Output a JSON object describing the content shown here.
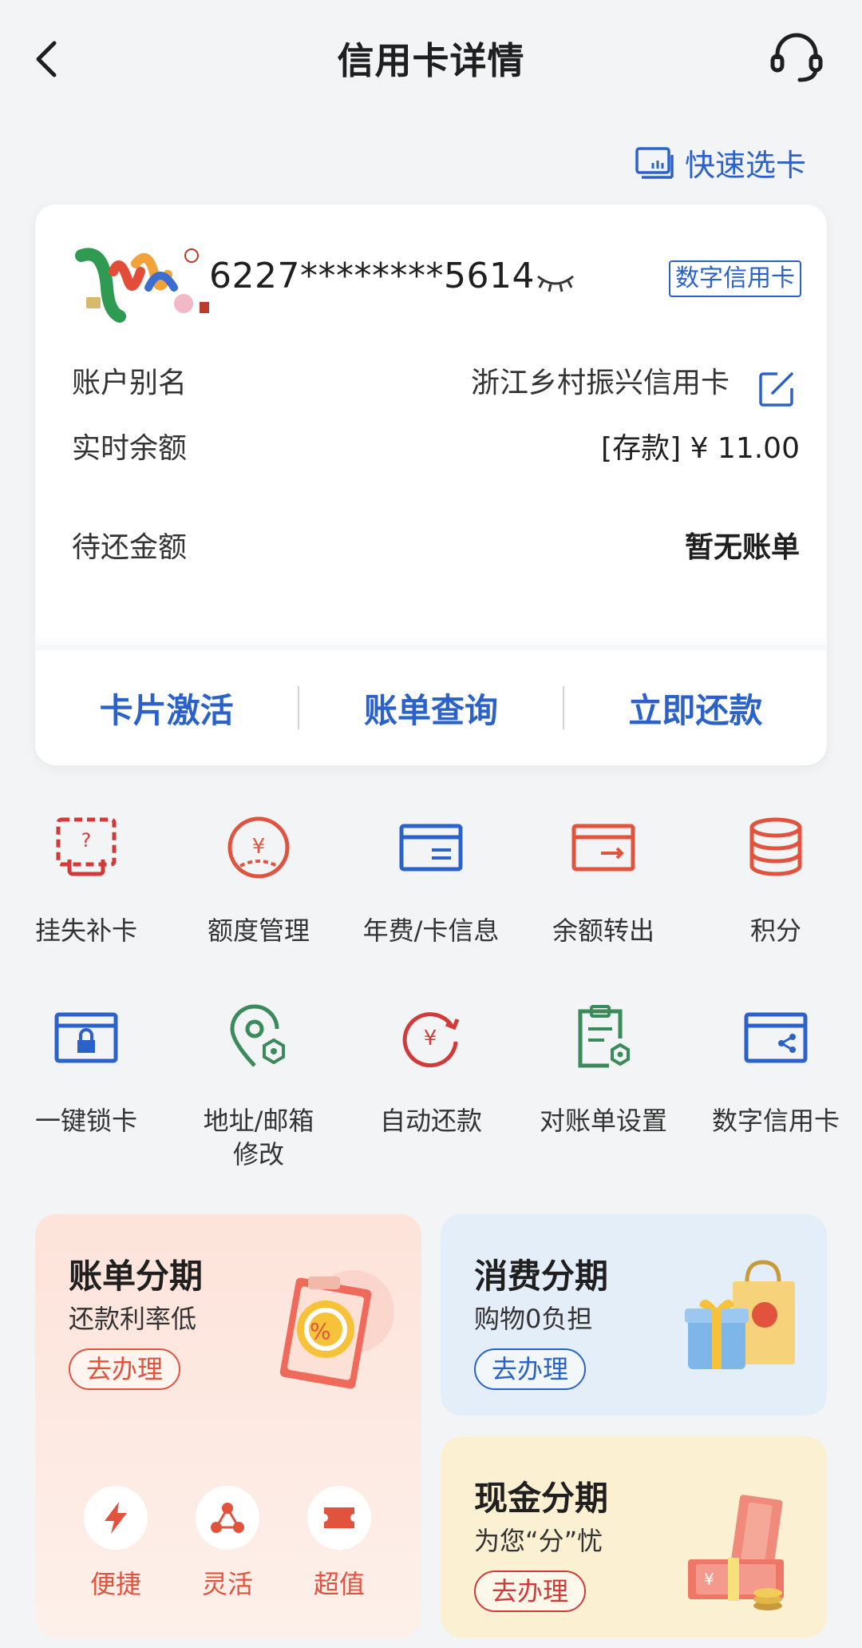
{
  "header": {
    "title": "信用卡详情"
  },
  "quick_select": {
    "label": "快速选卡"
  },
  "card": {
    "number": "6227********5614",
    "badge": "数字信用卡",
    "alias_label": "账户别名",
    "alias_value": "浙江乡村振兴信用卡",
    "balance_label": "实时余额",
    "balance_value": "[存款] ¥ 11.00",
    "due_label": "待还金额",
    "due_value": "暂无账单",
    "actions": [
      "卡片激活",
      "账单查询",
      "立即还款"
    ]
  },
  "services_row1": [
    {
      "label": "挂失补卡",
      "icon": "report-loss-icon"
    },
    {
      "label": "额度管理",
      "icon": "credit-limit-icon"
    },
    {
      "label": "年费/卡信息",
      "icon": "card-info-icon"
    },
    {
      "label": "余额转出",
      "icon": "balance-transfer-icon"
    },
    {
      "label": "积分",
      "icon": "points-icon"
    }
  ],
  "services_row2": [
    {
      "label": "一键锁卡",
      "icon": "lock-card-icon"
    },
    {
      "label_line1": "地址/邮箱",
      "label_line2": "修改",
      "icon": "address-icon"
    },
    {
      "label": "自动还款",
      "icon": "auto-repay-icon"
    },
    {
      "label": "对账单设置",
      "icon": "statement-settings-icon"
    },
    {
      "label": "数字信用卡",
      "icon": "digital-card-icon"
    }
  ],
  "promos": {
    "bill_installment": {
      "title": "账单分期",
      "subtitle": "还款利率低",
      "button": "去办理",
      "features": [
        "便捷",
        "灵活",
        "超值"
      ]
    },
    "consumer_installment": {
      "title": "消费分期",
      "subtitle": "购物0负担",
      "button": "去办理"
    },
    "cash_installment": {
      "title": "现金分期",
      "subtitle": "为您“分”忧",
      "button": "去办理"
    }
  },
  "colors": {
    "accent_blue": "#2b62c9",
    "accent_red": "#e2533e",
    "accent_green": "#3a8a5a",
    "pink_bg": "#fde8e1",
    "blue_bg": "#e4eef9",
    "yellow_bg": "#fbf0d2"
  }
}
